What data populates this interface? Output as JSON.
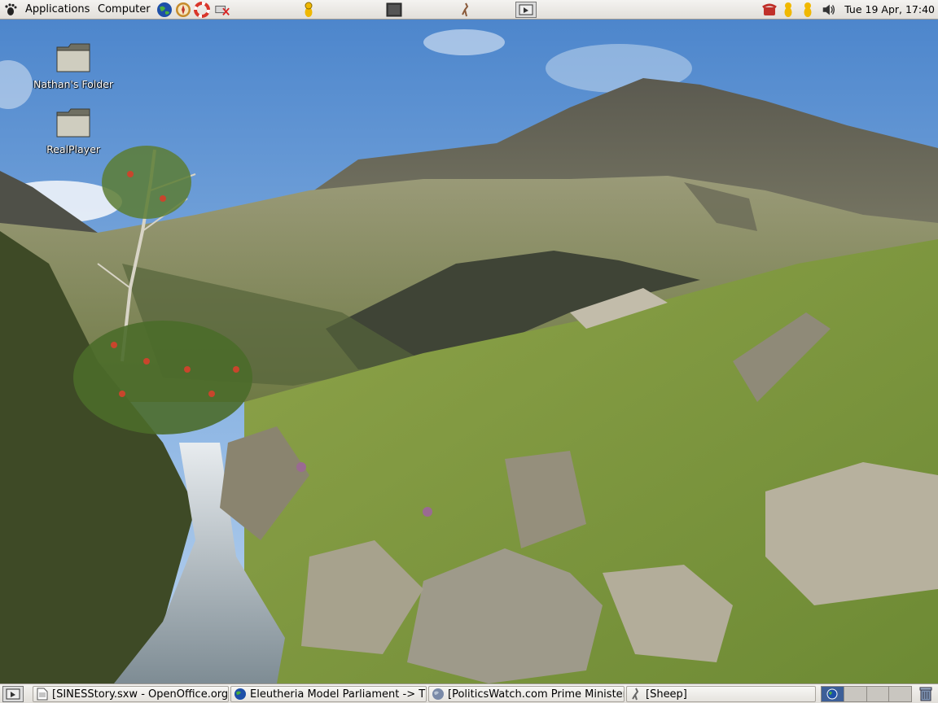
{
  "top_panel": {
    "menus": {
      "applications": "Applications",
      "computer": "Computer"
    },
    "launchers": [
      "web-browser",
      "help-lifebuoy",
      "mail-client",
      "remote-desktop"
    ],
    "notification_icons": [
      "foot-icon",
      "terminal-icon",
      "figure-icon",
      "show-desktop-icon",
      "phone-icon",
      "messenger-icon",
      "messenger-icon-2",
      "volume-icon"
    ],
    "clock": "Tue 19 Apr, 17:40"
  },
  "desktop": {
    "icons": [
      {
        "label": "Nathan's Folder",
        "icon": "folder-icon"
      },
      {
        "label": "RealPlayer",
        "icon": "folder-icon"
      }
    ]
  },
  "taskbar": {
    "tasks": [
      {
        "label": "[SINESStory.sxw - OpenOffice.org",
        "icon": "document-icon"
      },
      {
        "label": "Eleutheria Model Parliament -> Th",
        "icon": "globe-icon"
      },
      {
        "label": "[PoliticsWatch.com Prime Minister",
        "icon": "globe-icon"
      },
      {
        "label": "[Sheep]",
        "icon": "terminal-icon"
      }
    ],
    "workspaces": 4,
    "active_workspace": 1
  },
  "colors": {
    "panel": "#e8e6e2",
    "sky": "#5f93d4",
    "workspace_active": "#3d5f98"
  }
}
